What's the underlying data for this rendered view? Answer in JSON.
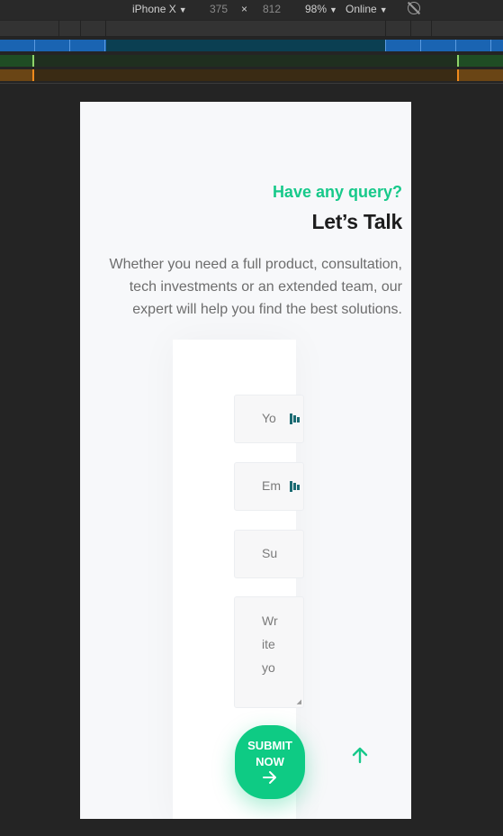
{
  "devtools": {
    "device": "iPhone X",
    "width": "375",
    "times": "×",
    "height": "812",
    "zoom": "98%",
    "network": "Online",
    "rotate_icon": "rotate-icon"
  },
  "page": {
    "kicker": "Have any query?",
    "title": "Let’s Talk",
    "description": "Whether you need a full product, consultation, tech investments or an extended team, our expert will help you find the best solutions."
  },
  "form": {
    "name_placeholder": "Yo",
    "email_placeholder": "Em",
    "subject_placeholder": "Su",
    "message_placeholder": "Write yo",
    "submit_label": "SUBMIT NOW",
    "field_icon": "password-manager-icon"
  },
  "colors": {
    "accent": "#0ecb84",
    "heading": "#1d1d1d",
    "body_text": "#6d6d6d"
  }
}
